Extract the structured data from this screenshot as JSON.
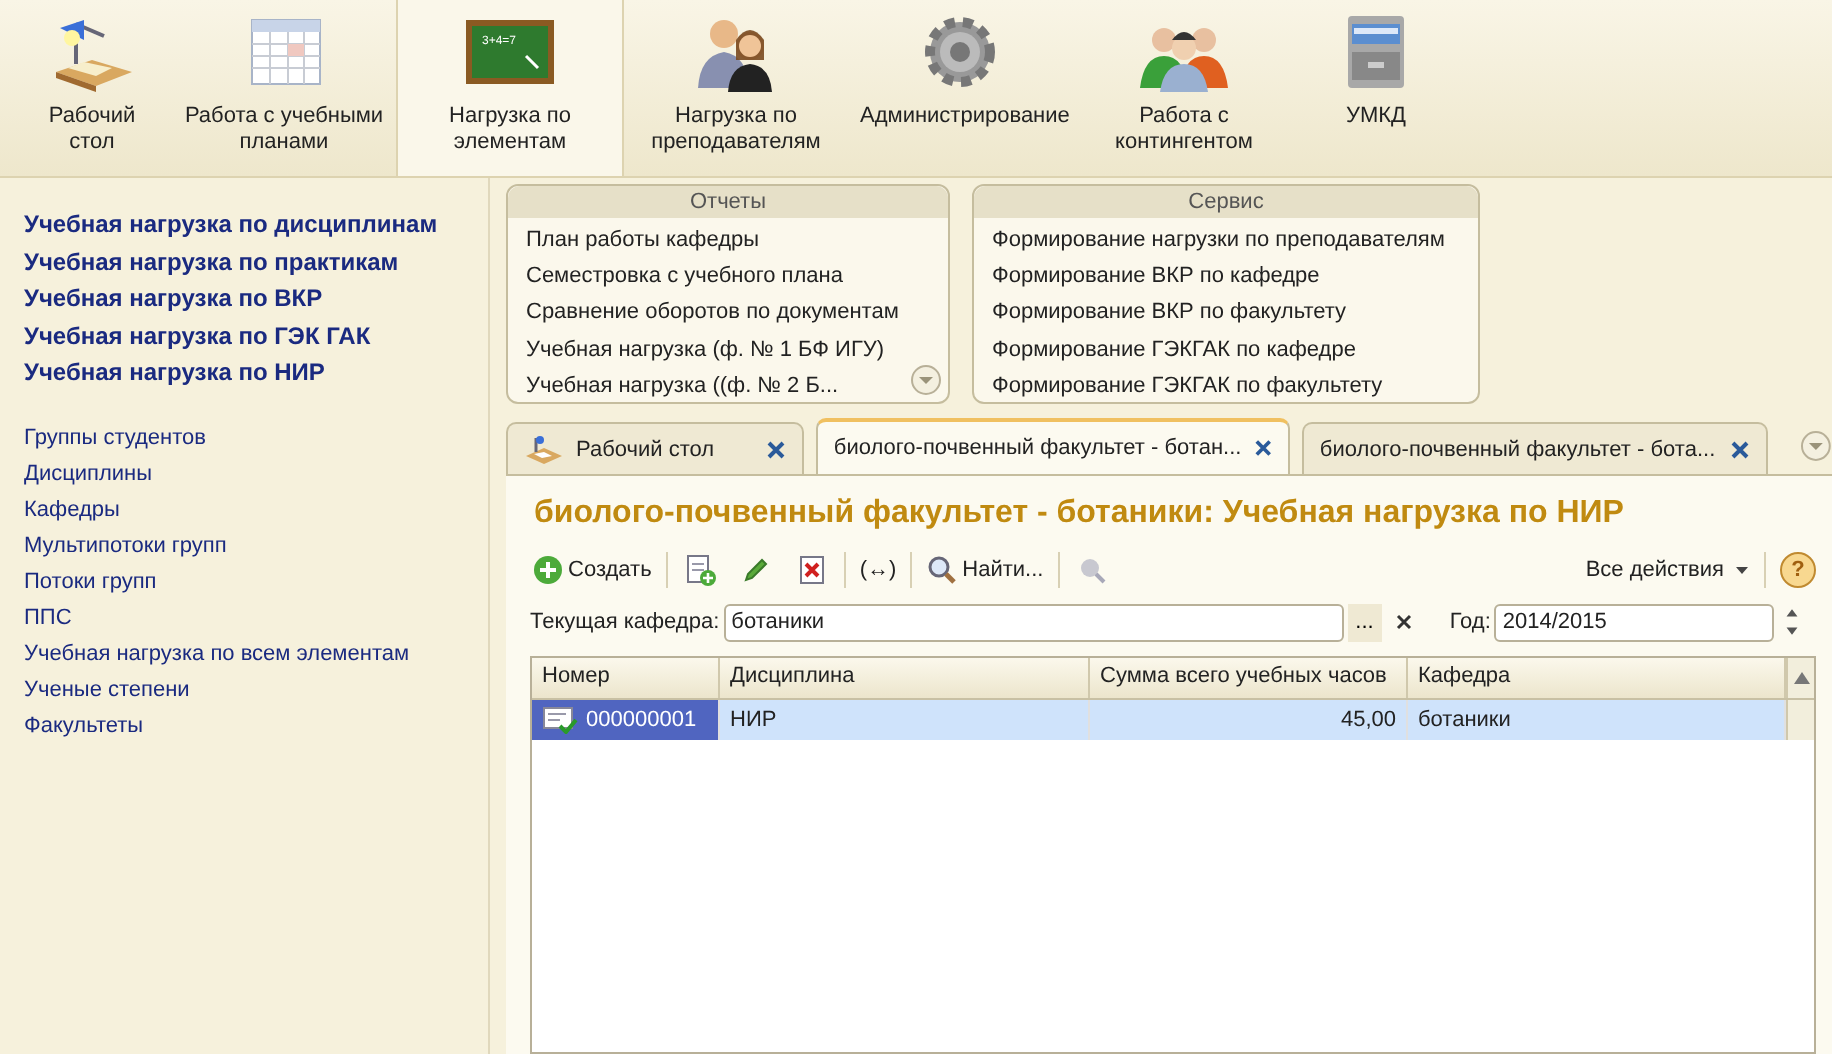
{
  "sections": [
    {
      "label": "Рабочий стол",
      "kind": "desk",
      "selected": false
    },
    {
      "label": "Работа с учебными планами",
      "kind": "calendar",
      "selected": false
    },
    {
      "label": "Нагрузка по элементам",
      "kind": "board",
      "board_text": "3+4=7",
      "selected": true
    },
    {
      "label": "Нагрузка по преподавателям",
      "kind": "people",
      "selected": false
    },
    {
      "label": "Администрирование",
      "kind": "gear",
      "selected": false
    },
    {
      "label": "Работа с контингентом",
      "kind": "group",
      "selected": false
    },
    {
      "label": "УМКД",
      "kind": "cabinet",
      "selected": false
    }
  ],
  "nav_main": [
    "Учебная нагрузка по дисциплинам",
    "Учебная нагрузка по практикам",
    "Учебная нагрузка по ВКР",
    "Учебная нагрузка по ГЭК ГАК",
    "Учебная нагрузка по НИР"
  ],
  "nav_other": [
    "Группы студентов",
    "Дисциплины",
    "Кафедры",
    "Мультипотоки групп",
    "Потоки групп",
    "ППС",
    "Учебная нагрузка по всем элементам",
    "Ученые степени",
    "Факультеты"
  ],
  "panels": [
    {
      "title": "Отчеты",
      "items": [
        "План работы кафедры",
        "Семестровка с учебного плана",
        "Сравнение оборотов по документам",
        "Учебная нагрузка (ф. № 1 БФ ИГУ)",
        "Учебная нагрузка ((ф. № 2 Б..."
      ],
      "more": true
    },
    {
      "title": "Сервис",
      "items": [
        "Формирование нагрузки по преподавателям",
        "Формирование ВКР по кафедре",
        "Формирование ВКР по факультету",
        "Формирование ГЭКГАК по кафедре",
        "Формирование ГЭКГАК по факультету"
      ],
      "more": false
    }
  ],
  "tabs": [
    {
      "label": "Рабочий стол",
      "kind": "home",
      "selected": false
    },
    {
      "label": "биолого-почвенный факультет - ботан...",
      "kind": "doc",
      "selected": true
    },
    {
      "label": "биолого-почвенный факультет - бота...",
      "kind": "doc",
      "selected": false
    }
  ],
  "form": {
    "title": "биолого-почвенный факультет - ботаники: Учебная нагрузка по НИР",
    "toolbar": {
      "create": "Создать",
      "toggle": "(↔)",
      "find": "Найти...",
      "all_actions": "Все действия",
      "help": "?"
    },
    "department": {
      "label": "Текущая кафедра:",
      "value": "ботаники",
      "select": "..."
    },
    "year": {
      "label": "Год:",
      "value": "2014/2015"
    },
    "table": {
      "columns": [
        "Номер",
        "Дисциплина",
        "Сумма всего учебных часов",
        "Кафедра"
      ],
      "rows": [
        {
          "cells": [
            "000000001",
            "НИР",
            "45,00",
            "ботаники"
          ],
          "selected": true
        }
      ]
    }
  }
}
